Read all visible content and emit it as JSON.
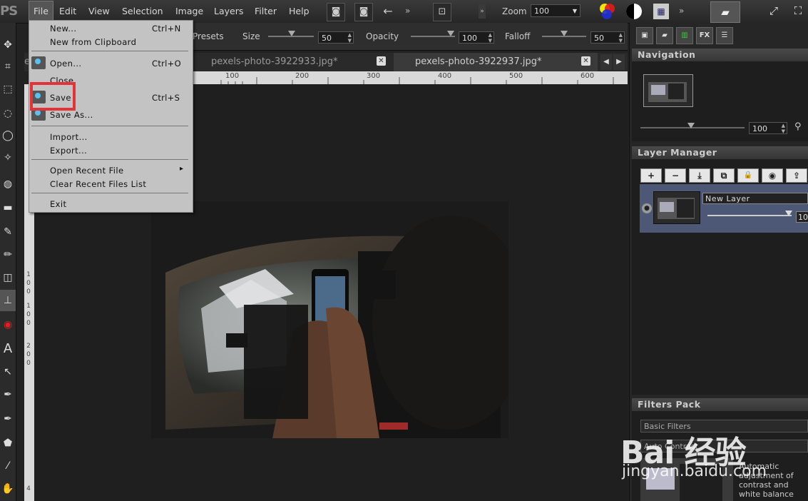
{
  "app": {
    "logo": "PS"
  },
  "menubar": {
    "items": [
      "File",
      "Edit",
      "View",
      "Selection",
      "Image",
      "Layers",
      "Filter",
      "Help"
    ],
    "more": "»",
    "zoom_label": "Zoom",
    "zoom_value": "100"
  },
  "options": {
    "presets_label": "Presets",
    "size_label": "Size",
    "size_value": "50",
    "opacity_label": "Opacity",
    "opacity_value": "100",
    "falloff_label": "Falloff",
    "falloff_value": "50"
  },
  "tabs": [
    {
      "label": "e"
    },
    {
      "label": "pexels-photo-3922933.jpg*"
    },
    {
      "label": "pexels-photo-3922937.jpg*"
    }
  ],
  "ruler": {
    "top_ticks": [
      "100",
      "200",
      "300",
      "400",
      "500",
      "600"
    ],
    "left_ticks": [
      "1",
      "0",
      "0",
      "1",
      "0",
      "0",
      "2",
      "0",
      "0",
      "4"
    ]
  },
  "file_menu": {
    "items": [
      {
        "label": "New...",
        "shortcut": "Ctrl+N"
      },
      {
        "label": "New from Clipboard",
        "shortcut": ""
      },
      {
        "label": "Open...",
        "shortcut": "Ctrl+O"
      },
      {
        "label": "Close",
        "shortcut": ""
      },
      {
        "label": "Save",
        "shortcut": "Ctrl+S"
      },
      {
        "label": "Save As...",
        "shortcut": ""
      },
      {
        "label": "Import...",
        "shortcut": ""
      },
      {
        "label": "Export...",
        "shortcut": ""
      },
      {
        "label": "Open Recent File",
        "shortcut": "▸"
      },
      {
        "label": "Clear Recent Files List",
        "shortcut": ""
      },
      {
        "label": "Exit",
        "shortcut": ""
      }
    ]
  },
  "right_panel": {
    "fx_tab": "FX",
    "navigation_title": "Navigation",
    "nav_zoom": "100",
    "layer_manager_title": "Layer Manager",
    "layer_buttons": [
      "+",
      "−",
      "⤓",
      "⧉",
      "🔒",
      "◉",
      "⇪"
    ],
    "layer_name": "New Layer",
    "layer_opacity": "10",
    "filters_title": "Filters Pack",
    "filter_basic": "Basic Filters",
    "filter_auto": "Auto Contrast",
    "filter_desc": "Automatic adjustment of contrast and white balance"
  },
  "watermark": {
    "text1": "Bai 经验",
    "text2": "jingyan.baidu.com"
  },
  "colors": {
    "highlight": "#e3323a",
    "accent": "#5bc0f0",
    "layer_selected": "#4d5876"
  }
}
